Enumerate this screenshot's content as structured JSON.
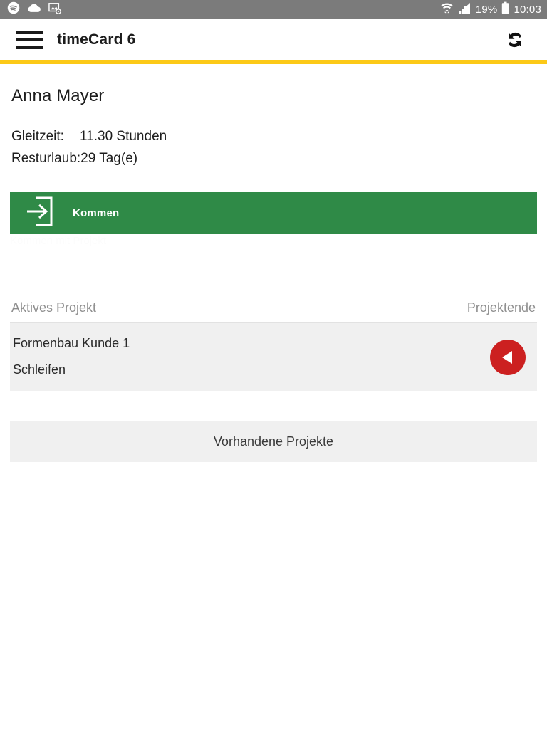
{
  "statusbar": {
    "left_icons": [
      "spotify-icon",
      "cloud-icon",
      "screenshot-icon"
    ],
    "right_icons": [
      "wifi-icon",
      "signal-icon",
      "battery-icon"
    ],
    "battery_percent": "19%",
    "clock": "10:03"
  },
  "appbar": {
    "menu_icon": "hamburger-menu-icon",
    "title": "timeCard 6",
    "sync_icon": "sync-icon"
  },
  "colors": {
    "accent_yellow": "#fcc917",
    "action_green": "#2f8a47",
    "stop_red": "#cc2020",
    "card_gray": "#f0f0f0",
    "statusbar_gray": "#7b7b7b"
  },
  "user": {
    "name": "Anna Mayer"
  },
  "stats": [
    {
      "label": "Gleitzeit:",
      "value": "11.30 Stunden"
    },
    {
      "label": "Resturlaub:",
      "value": "29 Tag(e)"
    }
  ],
  "action": {
    "icon": "login-arrow-icon",
    "label": "Kommen",
    "ghost_text": "Kommen mit Projekt"
  },
  "project_section": {
    "header_left": "Aktives Projekt",
    "header_right": "Projektende",
    "active_project": {
      "name": "Formenbau Kunde 1",
      "task": "Schleifen",
      "stop_icon": "stop-triangle-icon"
    },
    "existing_projects_label": "Vorhandene Projekte"
  }
}
